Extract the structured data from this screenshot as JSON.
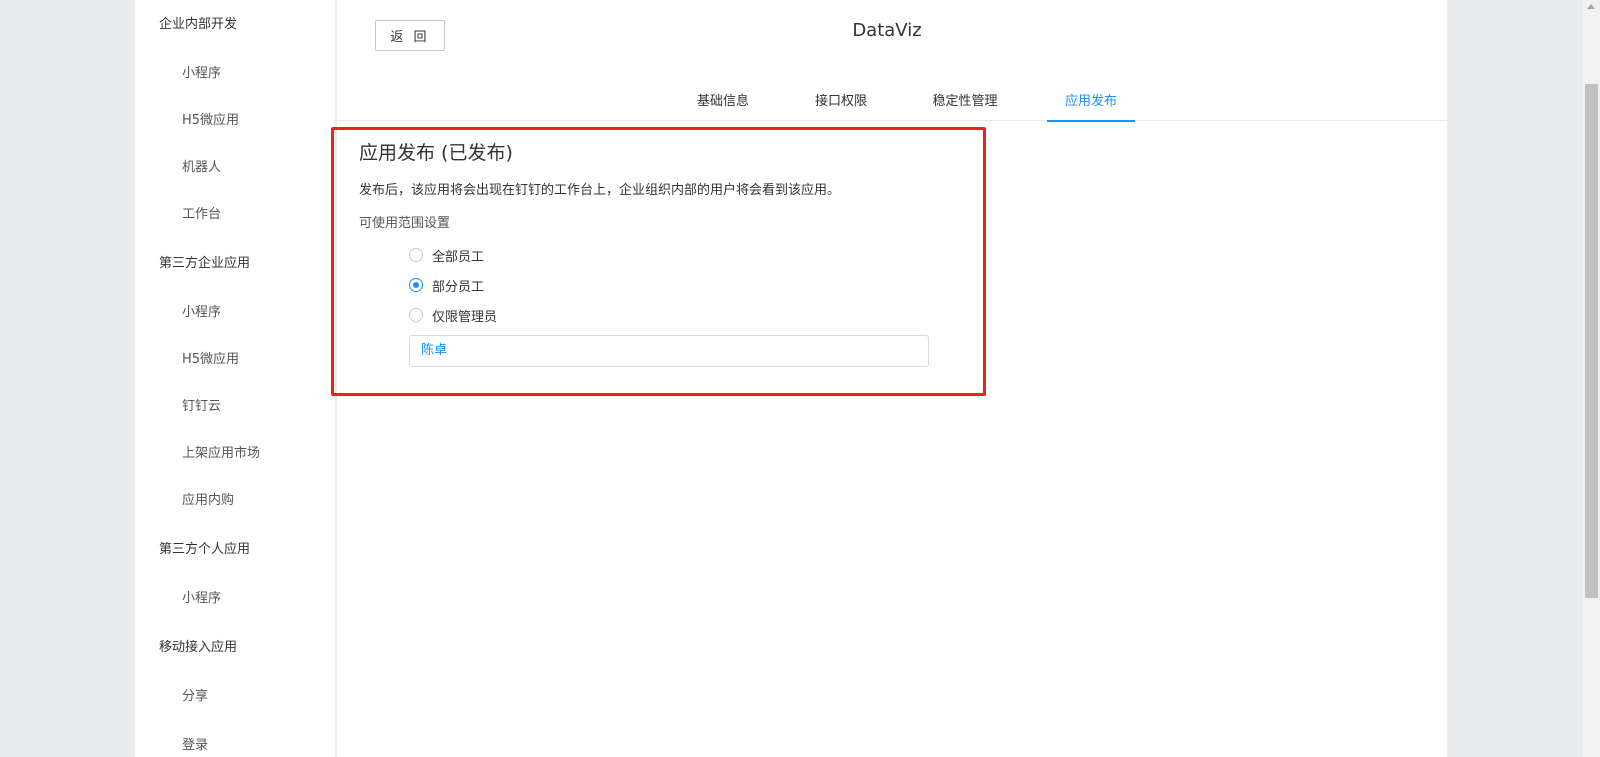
{
  "sidebar": {
    "groups": [
      {
        "title": "企业内部开发",
        "items": [
          "小程序",
          "H5微应用",
          "机器人",
          "工作台"
        ]
      },
      {
        "title": "第三方企业应用",
        "items": [
          "小程序",
          "H5微应用",
          "钉钉云",
          "上架应用市场",
          "应用内购"
        ]
      },
      {
        "title": "第三方个人应用",
        "items": [
          "小程序"
        ]
      },
      {
        "title": "移动接入应用",
        "items": [
          "分享",
          "登录"
        ]
      }
    ]
  },
  "header": {
    "back_label": "返 回",
    "app_title": "DataViz"
  },
  "tabs": [
    {
      "label": "基础信息"
    },
    {
      "label": "接口权限"
    },
    {
      "label": "稳定性管理"
    },
    {
      "label": "应用发布"
    }
  ],
  "publish": {
    "title": "应用发布 (已发布)",
    "description": "发布后，该应用将会出现在钉钉的工作台上，企业组织内部的用户将会看到该应用。",
    "scope_label": "可使用范围设置",
    "options": [
      {
        "label": "全部员工"
      },
      {
        "label": "部分员工"
      },
      {
        "label": "仅限管理员"
      }
    ],
    "selected_members": "陈卓"
  },
  "colors": {
    "accent": "#1890ff",
    "highlight": "#f0201a"
  }
}
